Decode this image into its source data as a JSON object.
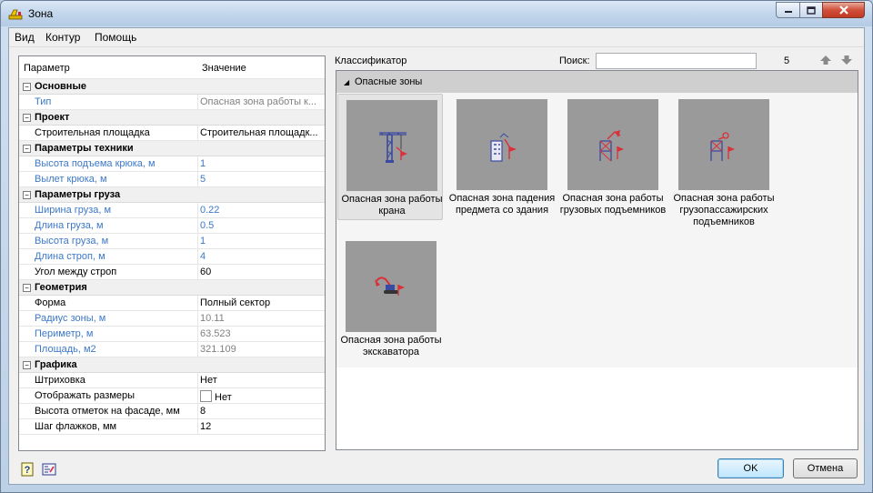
{
  "window": {
    "title": "Зона"
  },
  "menu": [
    "Вид",
    "Контур",
    "Помощь"
  ],
  "grid": {
    "col_param": "Параметр",
    "col_value": "Значение",
    "rows": [
      {
        "type": "group",
        "name": "Основные"
      },
      {
        "type": "prop",
        "name": "Тип",
        "value": "Опасная зона работы к...",
        "style": "gray"
      },
      {
        "type": "group",
        "name": "Проект"
      },
      {
        "type": "prop",
        "name": "Строительная площадка",
        "value": "Строительная площадк...",
        "style": "normal"
      },
      {
        "type": "group",
        "name": "Параметры техники"
      },
      {
        "type": "prop",
        "name": "Высота подъема крюка, м",
        "value": "1",
        "style": "blue"
      },
      {
        "type": "prop",
        "name": "Вылет крюка, м",
        "value": "5",
        "style": "blue"
      },
      {
        "type": "group",
        "name": "Параметры груза"
      },
      {
        "type": "prop",
        "name": "Ширина груза, м",
        "value": "0.22",
        "style": "blue"
      },
      {
        "type": "prop",
        "name": "Длина груза, м",
        "value": "0.5",
        "style": "blue"
      },
      {
        "type": "prop",
        "name": "Высота груза, м",
        "value": "1",
        "style": "blue"
      },
      {
        "type": "prop",
        "name": "Длина строп, м",
        "value": "4",
        "style": "blue"
      },
      {
        "type": "prop",
        "name": "Угол между строп",
        "value": "60",
        "style": "normal"
      },
      {
        "type": "group",
        "name": "Геометрия"
      },
      {
        "type": "prop",
        "name": "Форма",
        "value": "Полный сектор",
        "style": "normal"
      },
      {
        "type": "prop",
        "name": "Радиус зоны, м",
        "value": "10.11",
        "style": "gray"
      },
      {
        "type": "prop",
        "name": "Периметр, м",
        "value": "63.523",
        "style": "gray"
      },
      {
        "type": "prop",
        "name": "Площадь, м2",
        "value": "321.109",
        "style": "gray"
      },
      {
        "type": "group",
        "name": "Графика"
      },
      {
        "type": "prop",
        "name": "Штриховка",
        "value": "Нет",
        "style": "normal"
      },
      {
        "type": "check",
        "name": "Отображать размеры",
        "value": "Нет",
        "style": "normal"
      },
      {
        "type": "prop",
        "name": "Высота отметок на фасаде, мм",
        "value": "8",
        "style": "normal"
      },
      {
        "type": "prop",
        "name": "Шаг флажков, мм",
        "value": "12",
        "style": "normal"
      }
    ]
  },
  "classifier": {
    "label": "Классификатор",
    "search_label": "Поиск:",
    "search_value": "",
    "count": "5",
    "section": "Опасные зоны",
    "items": [
      {
        "label": "Опасная зона работы крана",
        "icon": "crane-icon",
        "selected": true
      },
      {
        "label": "Опасная зона падения предмета со здания",
        "icon": "building-fall-icon",
        "selected": false
      },
      {
        "label": "Опасная зона работы грузовых подъемников",
        "icon": "cargo-lift-icon",
        "selected": false
      },
      {
        "label": "Опасная зона работы грузопассажирских подъемников",
        "icon": "passenger-lift-icon",
        "selected": false
      },
      {
        "label": "Опасная зона работы экскаватора",
        "icon": "excavator-icon",
        "selected": false
      }
    ]
  },
  "buttons": {
    "ok": "OK",
    "cancel": "Отмена"
  },
  "colors": {
    "link_blue": "#3c78c8",
    "thumb_gray": "#9a9a9a",
    "danger_red": "#d9303a"
  }
}
